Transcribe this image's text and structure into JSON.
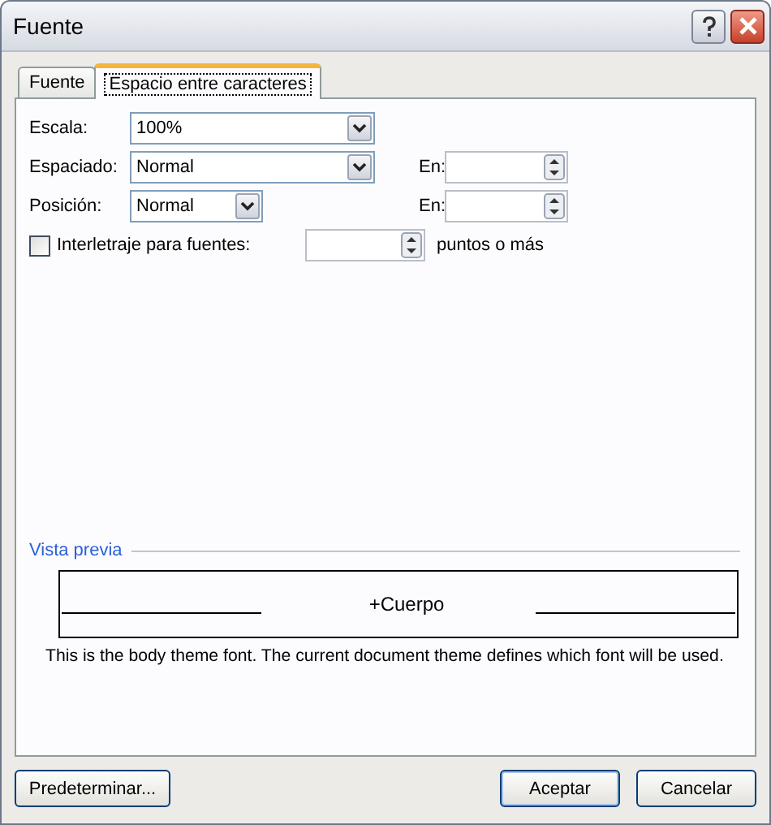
{
  "window": {
    "title": "Fuente"
  },
  "tabs": [
    {
      "label": "Fuente",
      "selected": false
    },
    {
      "label": "Espacio entre caracteres",
      "selected": true
    }
  ],
  "rows": [
    {
      "label": "Escala:",
      "value": "100%"
    },
    {
      "label": "Espaciado:",
      "value": "Normal",
      "spin_label": "En:"
    },
    {
      "label": "Posición:",
      "value": "Normal",
      "spin_label": "En:"
    }
  ],
  "kerning": {
    "label": "Interletraje para fuentes:",
    "checked": false,
    "suffix": "puntos o más"
  },
  "preview": {
    "legend": "Vista previa",
    "sample": "+Cuerpo",
    "description": "This is the body theme font. The current document theme defines which font will be used."
  },
  "buttons": [
    {
      "label": "Predeterminar...",
      "kind": "left"
    },
    {
      "label": "Aceptar",
      "kind": "default"
    },
    {
      "label": "Cancelar",
      "kind": "right"
    }
  ]
}
